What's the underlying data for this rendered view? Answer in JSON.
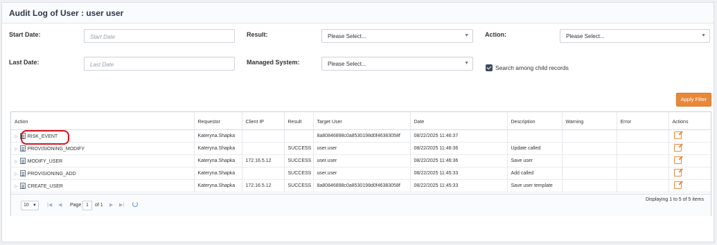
{
  "title": "Audit Log of User : user user",
  "filters": {
    "start_date": {
      "label": "Start Date:",
      "placeholder": "Start Date"
    },
    "last_date": {
      "label": "Last Date:",
      "placeholder": "Last Date"
    },
    "result": {
      "label": "Result:",
      "value": "Please Select..."
    },
    "managed_system": {
      "label": "Managed System:",
      "value": "Please Select..."
    },
    "action": {
      "label": "Action:",
      "value": "Please Select..."
    },
    "child_records": {
      "label": "Search among child records",
      "checked": true
    },
    "apply_label": "Apply Filter"
  },
  "table": {
    "columns": [
      "Action",
      "Requestor",
      "Client IP",
      "Result",
      "Target User",
      "Date",
      "Description",
      "Warning",
      "Error",
      "Actions"
    ],
    "rows": [
      {
        "action": "RISK_EVENT",
        "requestor": "Kateryna.Shapka",
        "client_ip": "",
        "result": "",
        "target_user": "8a80846898c0a8530198d0f46383058f",
        "date": "08/22/2025 11:46:37",
        "description": "",
        "warning": "",
        "error": ""
      },
      {
        "action": "PROVISIONING_MODIFY",
        "requestor": "Kateryna.Shapka",
        "client_ip": "",
        "result": "SUCCESS",
        "target_user": "user.user",
        "date": "08/22/2025 11:46:36",
        "description": "Update called",
        "warning": "",
        "error": ""
      },
      {
        "action": "MODIFY_USER",
        "requestor": "Kateryna.Shapka",
        "client_ip": "172.16.5.12",
        "result": "SUCCESS",
        "target_user": "user.user",
        "date": "08/22/2025 11:46:36",
        "description": "Save user",
        "warning": "",
        "error": ""
      },
      {
        "action": "PROVISIONING_ADD",
        "requestor": "Kateryna.Shapka",
        "client_ip": "",
        "result": "SUCCESS",
        "target_user": "user.user",
        "date": "08/22/2025 11:45:33",
        "description": "Add called",
        "warning": "",
        "error": ""
      },
      {
        "action": "CREATE_USER",
        "requestor": "Kateryna.Shapka",
        "client_ip": "172.16.5.12",
        "result": "SUCCESS",
        "target_user": "8a80846898c0a8530198d0f46383058f",
        "date": "08/22/2025 11:45:33",
        "description": "Save user template",
        "warning": "",
        "error": ""
      }
    ]
  },
  "pager": {
    "page_size": "10",
    "page_label": "Page",
    "page": "1",
    "of_label": "of 1",
    "info": "Displaying 1 to 5 of 5 items"
  },
  "colors": {
    "accent": "#e8893a",
    "highlight": "#d8111a"
  },
  "icons": {
    "row_icon": "document-icon",
    "row_action": "edit-icon",
    "expand": "expand-arrow-icon"
  }
}
